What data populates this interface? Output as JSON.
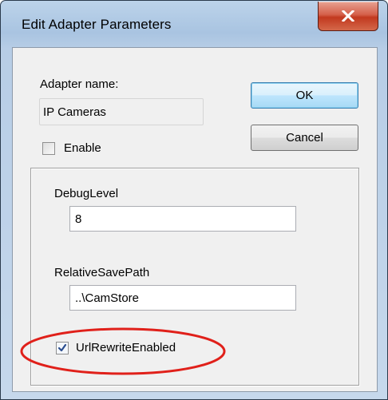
{
  "window": {
    "title": "Edit Adapter Parameters"
  },
  "form": {
    "adapter_name_label": "Adapter name:",
    "adapter_name_value": "IP Cameras",
    "enable_label": "Enable",
    "enable_checked": false
  },
  "buttons": {
    "ok_label": "OK",
    "cancel_label": "Cancel"
  },
  "parameters": {
    "debug_level_label": "DebugLevel",
    "debug_level_value": "8",
    "relative_save_path_label": "RelativeSavePath",
    "relative_save_path_value": "..\\CamStore",
    "url_rewrite_label": "UrlRewriteEnabled",
    "url_rewrite_checked": true
  },
  "colors": {
    "highlight_ellipse": "#e0201a",
    "close_button": "#c2391f"
  },
  "icons": {
    "close": "close-icon",
    "checkmark": "checkmark-icon"
  }
}
